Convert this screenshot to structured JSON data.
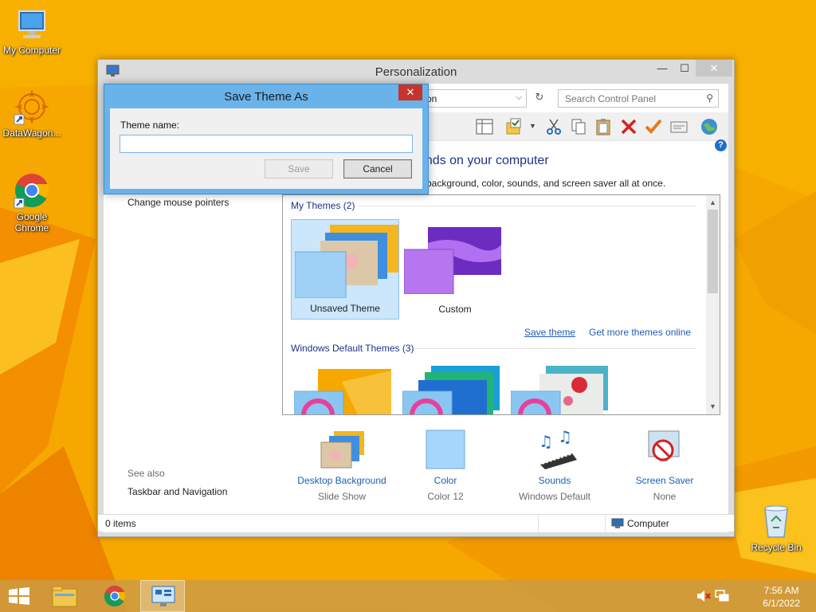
{
  "desktop": {
    "icons": [
      {
        "label": "My Computer"
      },
      {
        "label": "DataWagon..."
      },
      {
        "label": "Google Chrome"
      },
      {
        "label": "Recycle Bin"
      }
    ]
  },
  "window": {
    "title": "Personalization",
    "controls": {
      "minimize": "—",
      "maximize": "☐",
      "close": "✕"
    },
    "address_text": "on",
    "search_placeholder": "Search Control Panel",
    "heading": "unds on your computer",
    "subheading": "p background, color, sounds, and screen saver all at once.",
    "left_links": [
      "Change mouse pointers"
    ],
    "see_also": {
      "title": "See also",
      "links": [
        "Taskbar and Navigation"
      ]
    },
    "my_themes": {
      "title": "My Themes (2)",
      "items": [
        {
          "label": "Unsaved Theme",
          "selected": true
        },
        {
          "label": "Custom",
          "selected": false
        }
      ],
      "links": {
        "save": "Save theme",
        "more": "Get more themes online"
      }
    },
    "default_themes": {
      "title": "Windows Default Themes (3)"
    },
    "bottom_items": [
      {
        "title": "Desktop Background",
        "sub": "Slide Show"
      },
      {
        "title": "Color",
        "sub": "Color 12"
      },
      {
        "title": "Sounds",
        "sub": "Windows Default"
      },
      {
        "title": "Screen Saver",
        "sub": "None"
      }
    ],
    "status": {
      "items": "0 items",
      "location": "Computer"
    }
  },
  "dialog": {
    "title": "Save Theme As",
    "close": "✕",
    "label": "Theme name:",
    "value": "",
    "save_label": "Save",
    "cancel_label": "Cancel"
  },
  "taskbar": {
    "time": "7:56 AM",
    "date": "6/1/2022"
  },
  "colors": {
    "accent_blue": "#69b3ea",
    "link_blue": "#1e5eb0",
    "heading_blue": "#1e3287",
    "wallpaper_orange": "#f6a800"
  }
}
